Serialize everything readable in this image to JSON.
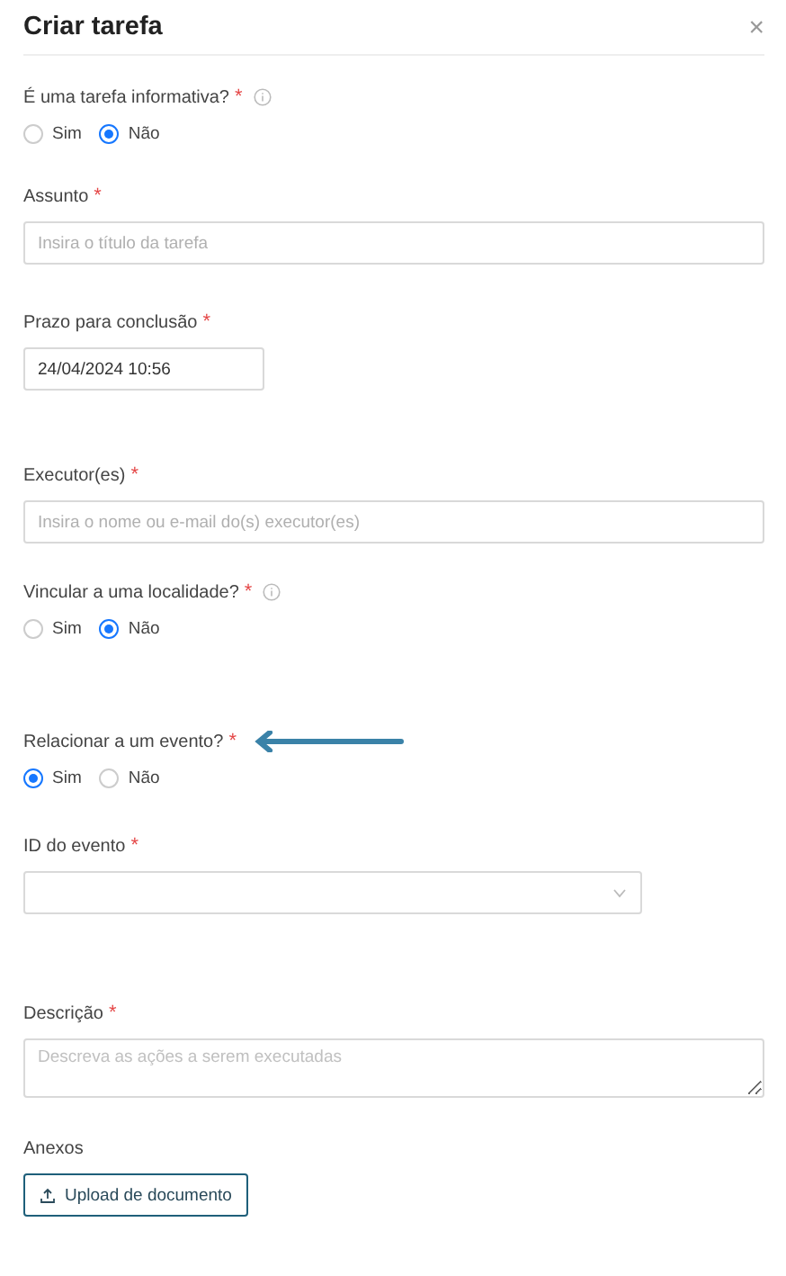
{
  "dialog": {
    "title": "Criar tarefa",
    "close": "×"
  },
  "fields": [
    {
      "kind": "radio",
      "label": "É uma tarefa informativa?",
      "required_mark": "*",
      "info": true,
      "highlighted": false,
      "options": [
        {
          "label": "Sim",
          "selected": false
        },
        {
          "label": "Não",
          "selected": true
        }
      ]
    },
    {
      "kind": "text",
      "label": "Assunto",
      "required_mark": "*",
      "info": false,
      "highlighted": false,
      "placeholder": "Insira o título da tarefa"
    },
    {
      "kind": "date",
      "label": "Prazo para conclusão",
      "required_mark": "*",
      "info": false,
      "highlighted": false,
      "value": "24/04/2024 10:56"
    },
    {
      "kind": "text",
      "label": "Executor(es)",
      "required_mark": "*",
      "info": false,
      "highlighted": false,
      "placeholder": "Insira o nome ou e-mail do(s) executor(es)"
    },
    {
      "kind": "radio",
      "label": "Vincular a uma localidade?",
      "required_mark": "*",
      "info": true,
      "highlighted": false,
      "options": [
        {
          "label": "Sim",
          "selected": false
        },
        {
          "label": "Não",
          "selected": true
        }
      ]
    },
    {
      "kind": "radio",
      "label": "Relacionar a um evento?",
      "required_mark": "*",
      "info": false,
      "highlighted": true,
      "options": [
        {
          "label": "Sim",
          "selected": true
        },
        {
          "label": "Não",
          "selected": false
        }
      ]
    },
    {
      "kind": "select",
      "label": "ID do evento",
      "required_mark": "*",
      "info": false,
      "highlighted": false
    },
    {
      "kind": "textarea",
      "label": "Descrição",
      "required_mark": "*",
      "info": false,
      "highlighted": false,
      "placeholder": "Descreva as ações a serem executadas"
    },
    {
      "kind": "upload",
      "label": "Anexos",
      "info": false,
      "highlighted": false,
      "button": "Upload de documento"
    }
  ]
}
